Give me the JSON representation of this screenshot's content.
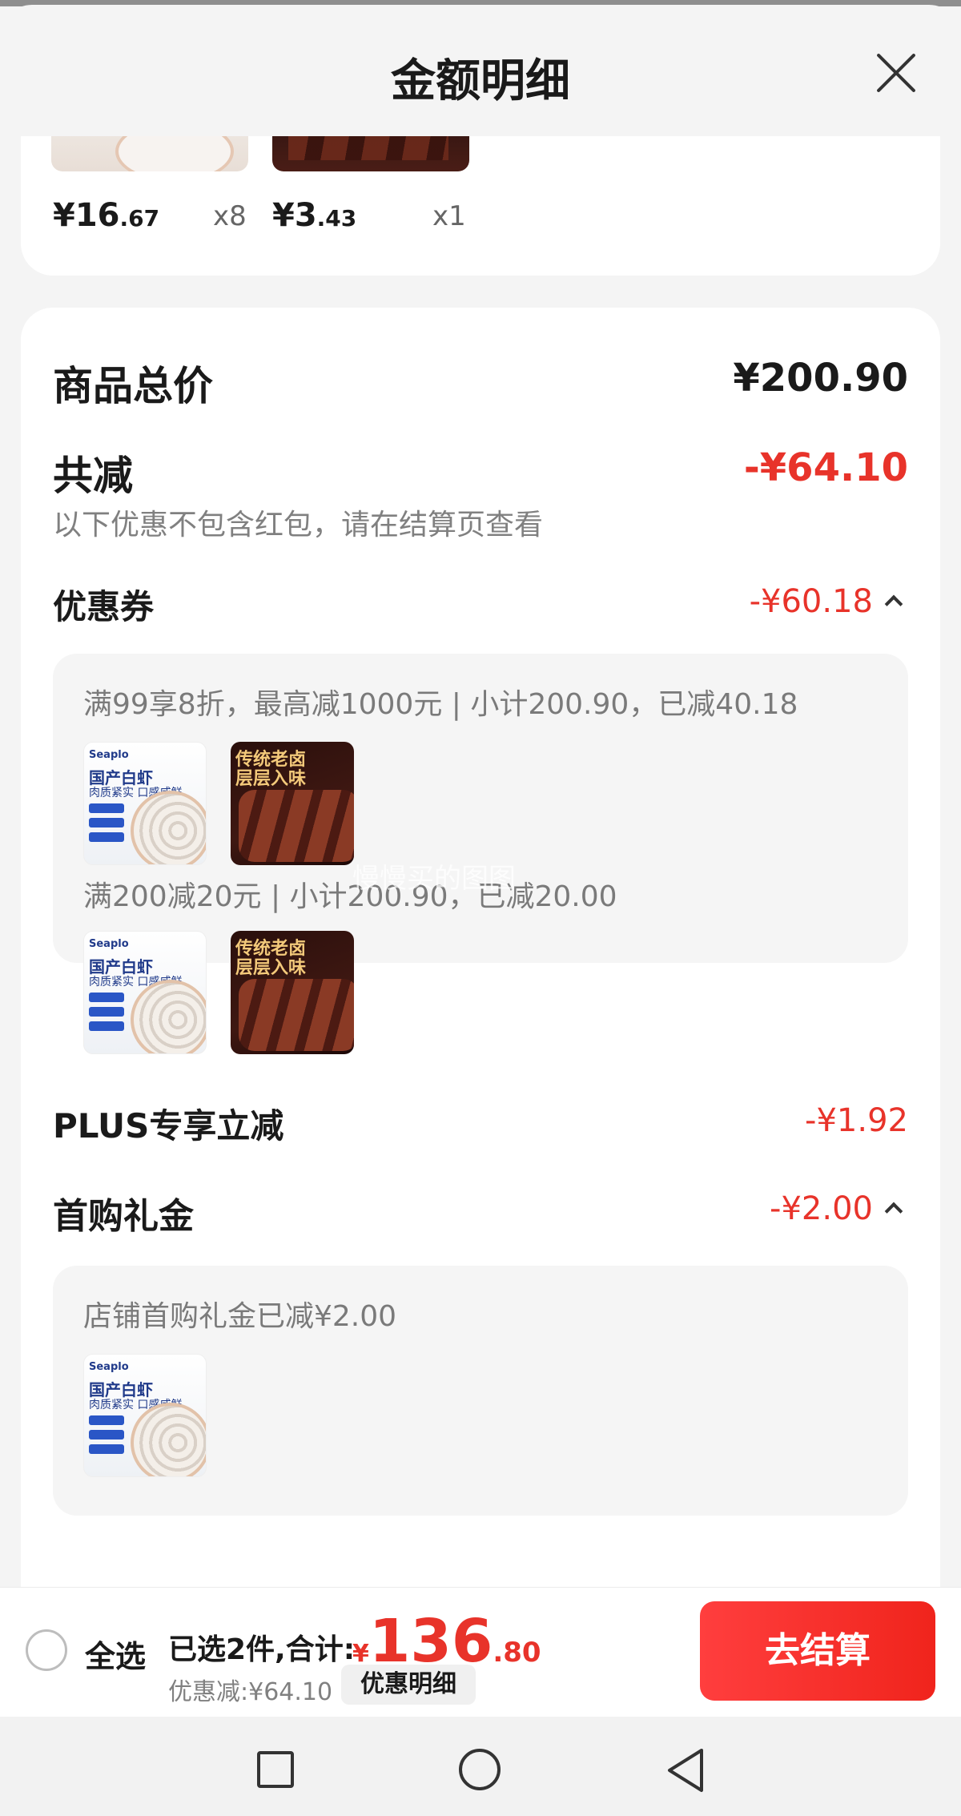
{
  "header": {
    "title": "金额明细"
  },
  "top_items": [
    {
      "price_int": "¥16",
      "price_dec": ".67",
      "qty": "x8"
    },
    {
      "price_int": "¥3",
      "price_dec": ".43",
      "qty": "x1"
    }
  ],
  "summary": {
    "total_label": "商品总价",
    "total_value": "¥200.90",
    "reduce_label": "共减",
    "reduce_value": "-¥64.10",
    "reduce_note": "以下优惠不包含红包，请在结算页查看"
  },
  "coupon": {
    "label": "优惠券",
    "value": "-¥60.18",
    "rules": [
      {
        "text": "满99享8折，最高减1000元 | 小计200.90，已减40.18"
      },
      {
        "text": "满200减20元 | 小计200.90，已减20.00"
      }
    ]
  },
  "product_thumbs": {
    "shrimp": {
      "brand": "Seaplo",
      "title": "国产白虾",
      "subtitle": "肉质紧实 口感咸鲜"
    },
    "duck": {
      "title": "传统老卤",
      "subtitle": "层层入味"
    }
  },
  "watermark": "慢慢买的图图",
  "plus": {
    "label": "PLUS专享立减",
    "value": "-¥1.92"
  },
  "first_buy": {
    "label": "首购礼金",
    "value": "-¥2.00",
    "note": "店铺首购礼金已减¥2.00"
  },
  "bottom_bar": {
    "select_all": "全选",
    "selected_text": "已选2件,合计:",
    "total_currency": "¥",
    "total_int": "136",
    "total_dec": ".80",
    "discount_text": "优惠减:¥64.10",
    "detail_button": "优惠明细",
    "checkout_button": "去结算"
  },
  "colors": {
    "accent_red": "#e8332a",
    "checkout_red": "#f0241c"
  },
  "icons": {
    "close": "close-icon",
    "expand": "chevron-up-icon",
    "nav_recent": "square-icon",
    "nav_home": "circle-icon",
    "nav_back": "triangle-back-icon"
  }
}
